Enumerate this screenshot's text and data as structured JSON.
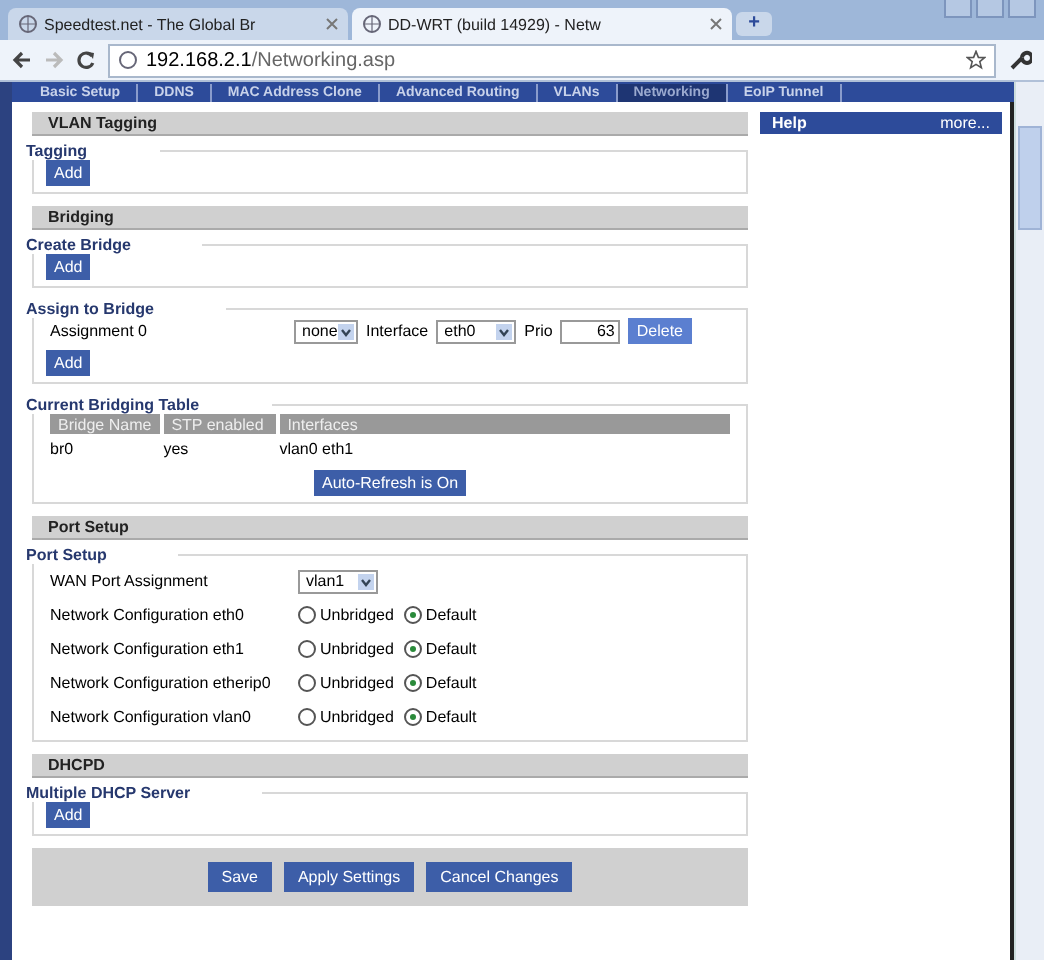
{
  "browser_tabs": [
    {
      "title": "Speedtest.net - The Global Br",
      "selected": false
    },
    {
      "title": "DD-WRT (build 14929) - Netw",
      "selected": true
    }
  ],
  "new_tab": "+",
  "address": {
    "host": "192.168.2.1",
    "path": "/Networking.asp"
  },
  "nav_tabs": [
    {
      "label": "Basic Setup",
      "selected": false
    },
    {
      "label": "DDNS",
      "selected": false
    },
    {
      "label": "MAC Address Clone",
      "selected": false
    },
    {
      "label": "Advanced Routing",
      "selected": false
    },
    {
      "label": "VLANs",
      "selected": false
    },
    {
      "label": "Networking",
      "selected": true
    },
    {
      "label": "EoIP Tunnel",
      "selected": false
    }
  ],
  "help": {
    "title": "Help",
    "more": "more..."
  },
  "vlan_tagging": {
    "heading": "VLAN Tagging",
    "legend": "Tagging",
    "add": "Add"
  },
  "bridging": {
    "heading": "Bridging",
    "create": {
      "legend": "Create Bridge",
      "add": "Add"
    },
    "assign": {
      "legend": "Assign to Bridge",
      "assignment_label": "Assignment 0",
      "bridge": "none",
      "interface_label": "Interface",
      "interface": "eth0",
      "prio_label": "Prio",
      "prio": "63",
      "delete": "Delete",
      "add": "Add"
    },
    "table": {
      "legend": "Current Bridging Table",
      "columns": [
        "Bridge Name",
        "STP enabled",
        "Interfaces"
      ],
      "rows": [
        [
          "br0",
          "yes",
          "vlan0 eth1"
        ]
      ],
      "refresh": "Auto-Refresh is On"
    }
  },
  "port_setup": {
    "heading": "Port Setup",
    "legend": "Port Setup",
    "wan_label": "WAN Port Assignment",
    "wan_value": "vlan1",
    "configs": [
      {
        "label": "Network Configuration eth0",
        "options": [
          {
            "label": "Unbridged",
            "selected": false
          },
          {
            "label": "Default",
            "selected": true
          }
        ]
      },
      {
        "label": "Network Configuration eth1",
        "options": [
          {
            "label": "Unbridged",
            "selected": false
          },
          {
            "label": "Default",
            "selected": true
          }
        ]
      },
      {
        "label": "Network Configuration etherip0",
        "options": [
          {
            "label": "Unbridged",
            "selected": false
          },
          {
            "label": "Default",
            "selected": true
          }
        ]
      },
      {
        "label": "Network Configuration vlan0",
        "options": [
          {
            "label": "Unbridged",
            "selected": false
          },
          {
            "label": "Default",
            "selected": true
          }
        ]
      }
    ]
  },
  "dhcpd": {
    "heading": "DHCPD",
    "legend": "Multiple DHCP Server",
    "add": "Add"
  },
  "buttons": [
    "Save",
    "Apply Settings",
    "Cancel Changes"
  ]
}
